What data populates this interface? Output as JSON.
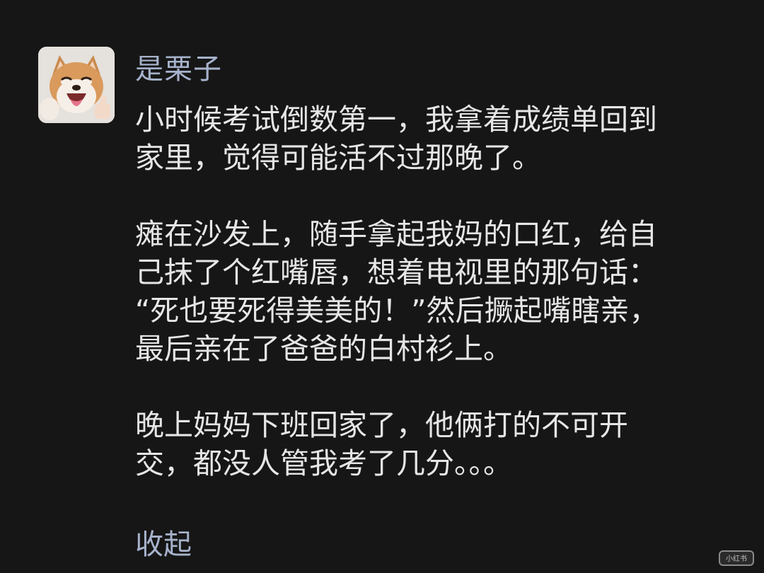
{
  "post": {
    "author": {
      "name": "是栗子",
      "avatar_icon": "shiba-dog-avatar-icon"
    },
    "paragraphs": [
      {
        "lines": [
          "小时候考试倒数第一，我拿着成绩单回到",
          "家里，觉得可能活不过那晚了。"
        ]
      },
      {
        "lines": [
          "瘫在沙发上，随手拿起我妈的口红，给自",
          "己抹了个红嘴唇，想着电视里的那句话：",
          "“死也要死得美美的！”然后撅起嘴瞎亲，",
          "最后亲在了爸爸的白村衫上。"
        ]
      },
      {
        "lines": [
          "晚上妈妈下班回家了，他俩打的不可开",
          "交，都没人管我考了几分。。。"
        ]
      }
    ],
    "collapse_label": "收起"
  },
  "watermark": {
    "label": "小红书"
  },
  "colors": {
    "background": "#161616",
    "text": "#e6e6e6",
    "accent": "#a6b3cc"
  }
}
